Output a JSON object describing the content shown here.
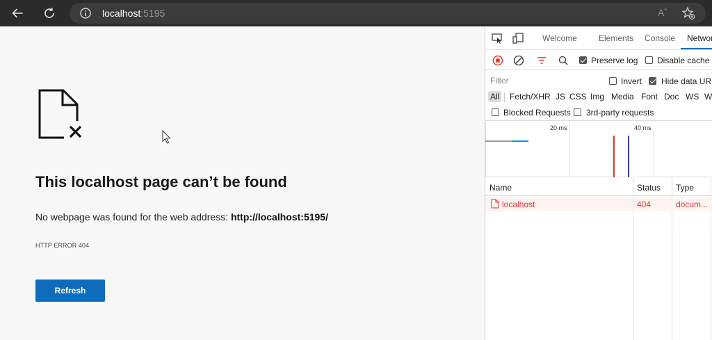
{
  "browser": {
    "url_host": "localhost",
    "url_port": ":5195",
    "read_aloud_glyph": "A",
    "read_aloud_sup": "ᴬ"
  },
  "error_page": {
    "title": "This localhost page can’t be found",
    "description_prefix": "No webpage was found for the web address: ",
    "description_url": "http://localhost:5195/",
    "error_code": "HTTP ERROR 404",
    "refresh_label": "Refresh"
  },
  "devtools": {
    "tabs": [
      "Welcome",
      "Elements",
      "Console",
      "Network"
    ],
    "active_tab": "Network",
    "preserve_log_label": "Preserve log",
    "preserve_log_checked": true,
    "disable_cache_label": "Disable cache",
    "disable_cache_checked": false,
    "filter_placeholder": "Filter",
    "invert_label": "Invert",
    "invert_checked": false,
    "hide_data_urls_label": "Hide data URLs",
    "hide_data_urls_checked": true,
    "type_filters": [
      "All",
      "Fetch/XHR",
      "JS",
      "CSS",
      "Img",
      "Media",
      "Font",
      "Doc",
      "WS",
      "Wasm"
    ],
    "blocked_requests_label": "Blocked Requests",
    "blocked_requests_checked": false,
    "third_party_label": "3rd-party requests",
    "third_party_checked": false,
    "timeline_labels": [
      "20 ms",
      "40 ms"
    ],
    "columns": [
      "Name",
      "Status",
      "Type"
    ],
    "requests": [
      {
        "name": "localhost",
        "status": "404",
        "type": "docum..."
      }
    ],
    "error_color": "#d83b2a"
  }
}
